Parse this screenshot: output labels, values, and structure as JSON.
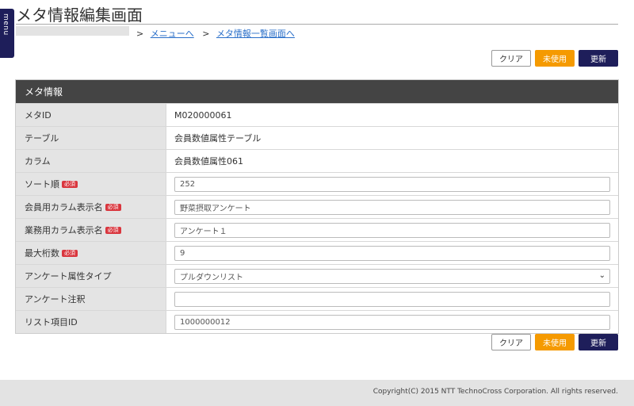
{
  "menu_tab": {
    "label": "menu"
  },
  "page": {
    "title": "メタ情報編集画面"
  },
  "breadcrumb": {
    "sep": ">",
    "link_menu": "メニューへ",
    "link_list": "メタ情報一覧画面へ"
  },
  "buttons": {
    "clear": "クリア",
    "unused": "未使用",
    "update": "更新"
  },
  "panel": {
    "title": "メタ情報",
    "required_badge": "必須",
    "rows": {
      "meta_id": {
        "label": "メタID",
        "value": "M020000061"
      },
      "table": {
        "label": "テーブル",
        "value": "会員数値属性テーブル"
      },
      "column": {
        "label": "カラム",
        "value": "会員数値属性061"
      },
      "sort_order": {
        "label": "ソート順",
        "value": "252"
      },
      "member_column_name": {
        "label": "会員用カラム表示名",
        "value": "野菜摂取アンケート"
      },
      "business_column_name": {
        "label": "業務用カラム表示名",
        "value": "アンケート１"
      },
      "max_digits": {
        "label": "最大桁数",
        "value": "9"
      },
      "survey_attr_type": {
        "label": "アンケート属性タイプ",
        "value": "プルダウンリスト"
      },
      "survey_note": {
        "label": "アンケート注釈",
        "value": ""
      },
      "list_item_id": {
        "label": "リスト項目ID",
        "value": "1000000012"
      }
    }
  },
  "footer": {
    "copyright": "Copyright(C) 2015 NTT TechnoCross Corporation. All rights reserved."
  }
}
